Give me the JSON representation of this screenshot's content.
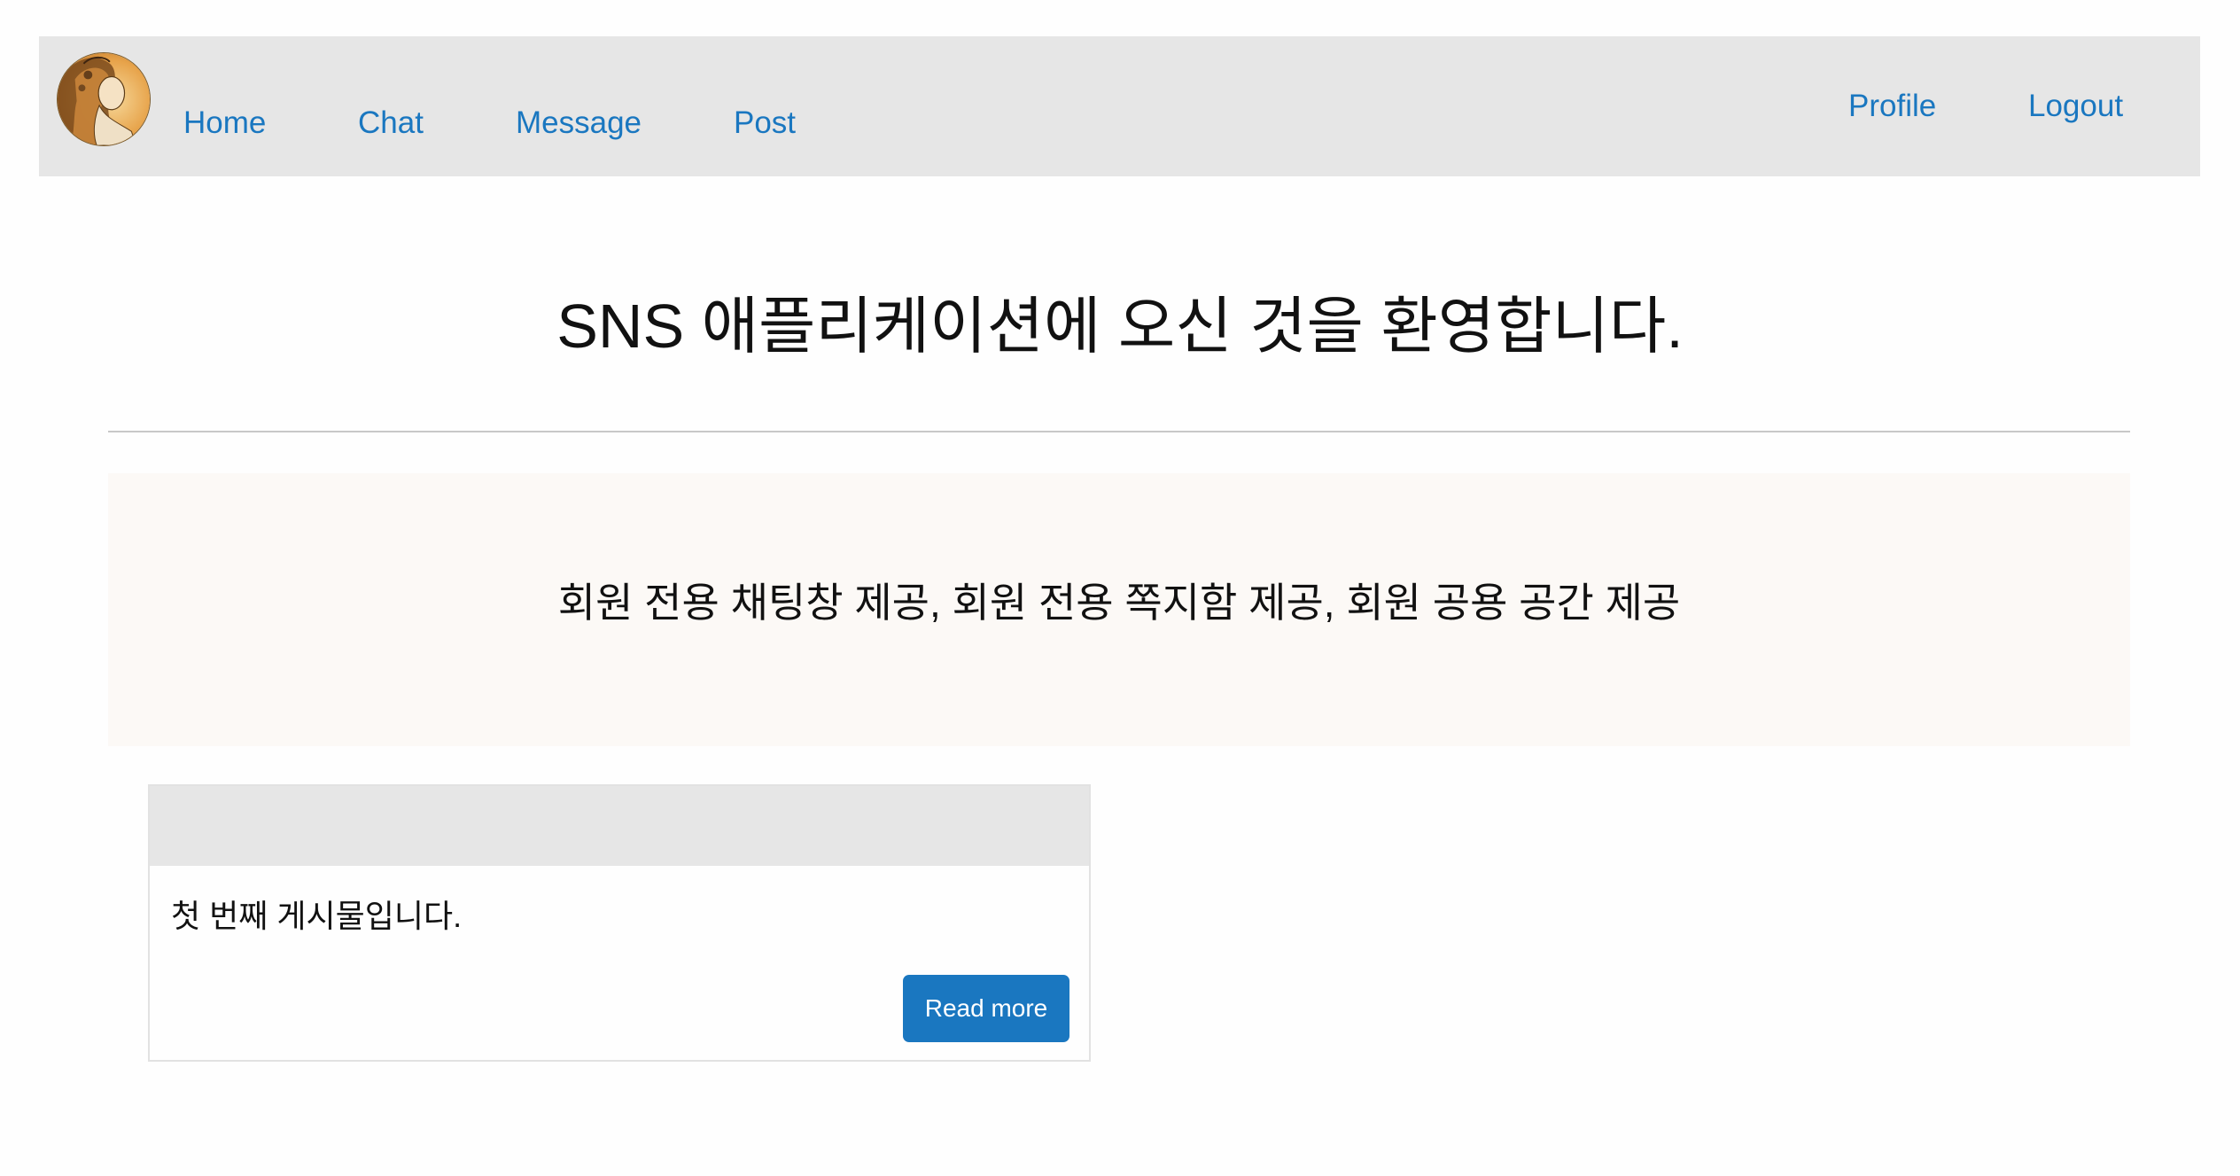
{
  "navbar": {
    "left_links": [
      {
        "label": "Home"
      },
      {
        "label": "Chat"
      },
      {
        "label": "Message"
      },
      {
        "label": "Post"
      }
    ],
    "right_links": [
      {
        "label": "Profile"
      },
      {
        "label": "Logout"
      }
    ],
    "logo_icon": "art-nouveau-portrait-avatar",
    "link_color": "#1a77c0",
    "background": "#e6e6e6"
  },
  "main": {
    "title": "SNS 애플리케이션에 오신 것을 환영합니다.",
    "jumbotron_text": "회원 전용 채팅창 제공, 회원 전용 쪽지함 제공, 회원 공용 공간 제공",
    "jumbotron_background": "#fcf9f6"
  },
  "post_card": {
    "header_text": "",
    "body_text": "첫 번째 게시물입니다.",
    "button_label": "Read more",
    "button_color": "#1a77c0"
  }
}
